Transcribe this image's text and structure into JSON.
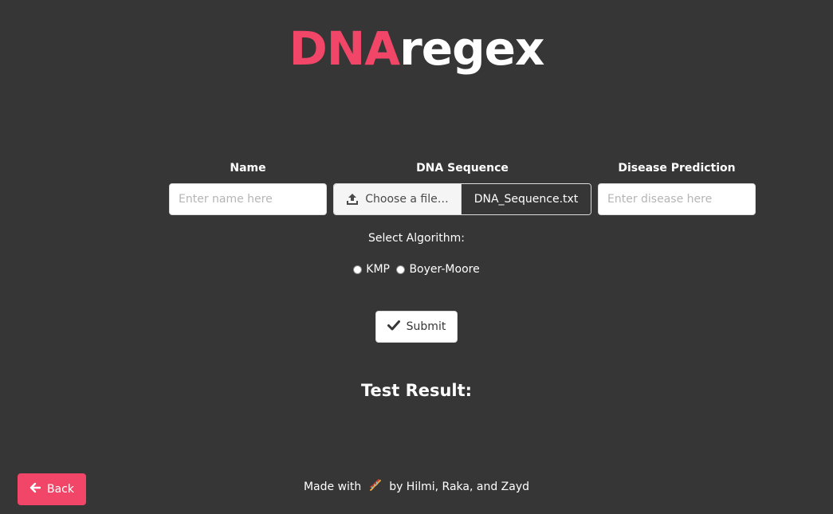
{
  "logo": {
    "accent": "DNA",
    "rest": "regex"
  },
  "form": {
    "name_label": "Name",
    "name_placeholder": "Enter name here",
    "dna_label": "DNA Sequence",
    "file_button_label": "Choose a file…",
    "file_name": "DNA_Sequence.txt",
    "disease_label": "Disease Prediction",
    "disease_placeholder": "Enter disease here",
    "algorithm_label": "Select Algorithm:",
    "algorithm_options": [
      "KMP",
      "Boyer-Moore"
    ],
    "submit_label": "Submit"
  },
  "result": {
    "title": "Test Result:"
  },
  "footer": {
    "before": "Made with",
    "emoji": "dna-icon",
    "after": "by Hilmi, Raka, and Zayd"
  },
  "back_label": "Back",
  "colors": {
    "background": "#363636",
    "accent": "#f14668",
    "text": "#ffffff"
  }
}
